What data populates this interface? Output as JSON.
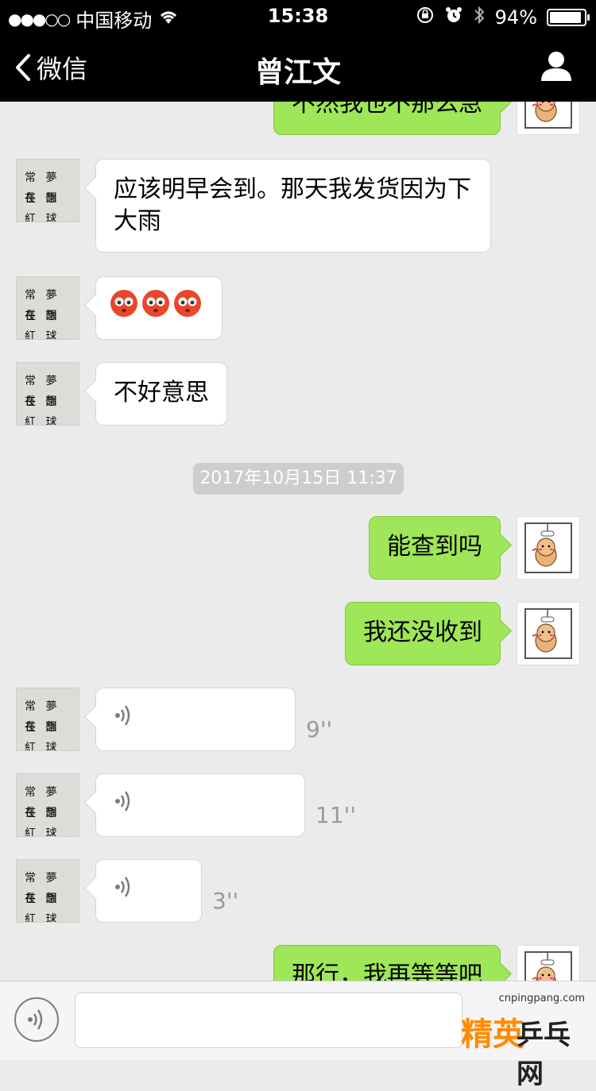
{
  "status_bar": {
    "signal": "●●●○○",
    "carrier": "中国移动",
    "time": "15:38",
    "battery": "94%",
    "battery_level": 0.94
  },
  "nav": {
    "back_label": "微信",
    "title": "曾江文"
  },
  "messages": [
    {
      "side": "out",
      "type": "text",
      "text": "不然我也不那么急"
    },
    {
      "side": "in",
      "type": "text",
      "text": "应该明早会到。那天我发货因为下大雨"
    },
    {
      "side": "in",
      "type": "emoji",
      "emoji": [
        "😳",
        "😳",
        "😳"
      ]
    },
    {
      "side": "in",
      "type": "text",
      "text": "不好意思"
    },
    {
      "type": "timestamp",
      "text": "2017年10月15日 11:37"
    },
    {
      "side": "out",
      "type": "text",
      "text": "能查到吗"
    },
    {
      "side": "out",
      "type": "text",
      "text": "我还没收到"
    },
    {
      "side": "in",
      "type": "voice",
      "duration": "9''"
    },
    {
      "side": "in",
      "type": "voice",
      "duration": "11''"
    },
    {
      "side": "in",
      "type": "voice",
      "duration": "3''"
    },
    {
      "side": "out",
      "type": "text",
      "text": "那行，我再等等吧"
    }
  ],
  "avatar_text": {
    "row1": "常 夢 長 園",
    "row2": "在 想 紅 球"
  },
  "watermark": {
    "url": "cnpingpang.com",
    "brand_a": "精英",
    "brand_b": "乒乓网"
  },
  "colors": {
    "outgoing_bubble": "#9fe658",
    "incoming_bubble": "#ffffff",
    "background": "#ebebeb"
  }
}
